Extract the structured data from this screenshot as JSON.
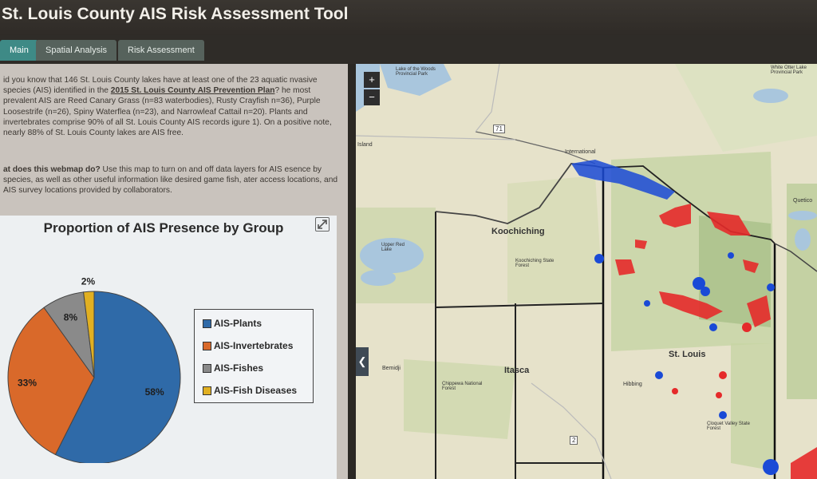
{
  "app": {
    "title": "St. Louis County AIS Risk Assessment Tool"
  },
  "tabs": [
    {
      "label": "Main"
    },
    {
      "label": "Spatial Analysis"
    },
    {
      "label": "Risk Assessment"
    }
  ],
  "intro": {
    "p1_a": "id you know that 146 St. Louis County lakes have at least one of the 23 aquatic nvasive species (AIS) identified in the ",
    "p1_link": "2015 St. Louis County AIS Prevention Plan",
    "p1_b": "? he most prevalent AIS are Reed Canary Grass (n=83 waterbodies), Rusty Crayfish n=36), Purple Loosestrife (n=26), Spiny Waterflea (n=23), and Narrowleaf Cattail n=20). Plants and invertebrates comprise 90% of all St. Louis County AIS records igure 1). On a positive note, nearly 88% of St. Louis County lakes are AIS free.",
    "p2_bold": "at does this webmap do?",
    "p2_rest": " Use this map to turn on and off data layers for AIS esence by species, as well as other useful information like desired game fish, ater access locations, and AIS survey locations provided by collaborators."
  },
  "colors": {
    "plants": "#2f6aa8",
    "invertebrates": "#d9692a",
    "fishes": "#8a8a8a",
    "fish_diseases": "#e1b022",
    "accent": "#3e8a86"
  },
  "chart_data": {
    "type": "pie",
    "title": "Proportion of AIS Presence by Group",
    "categories": [
      "AIS-Plants",
      "AIS-Invertebrates",
      "AIS-Fishes",
      "AIS-Fish Diseases"
    ],
    "values": [
      58,
      33,
      8,
      2
    ],
    "data_labels": [
      "58%",
      "33%",
      "8%",
      "2%"
    ],
    "legend_position": "right"
  },
  "map": {
    "zoom_in": "+",
    "zoom_out": "−",
    "collapse": "❮",
    "labels": {
      "koochiching": "Koochiching",
      "st_louis": "St. Louis",
      "itasca": "Itasca",
      "international": "International",
      "koochiching_sf": "Koochiching State Forest",
      "upper_red_lake": "Upper Red Lake",
      "lake_woods": "Lake of the Woods Provincial Park",
      "hibbing": "Hibbing",
      "bemidji": "Bemidji",
      "island": "Island",
      "cloquet": "Cloquet Valley State Forest",
      "chippewa": "Chippewa National Forest",
      "route_71": "71",
      "route_2": "2",
      "quetico": "Quetico",
      "white_otter": "White Otter Lake Provincial Park"
    }
  }
}
